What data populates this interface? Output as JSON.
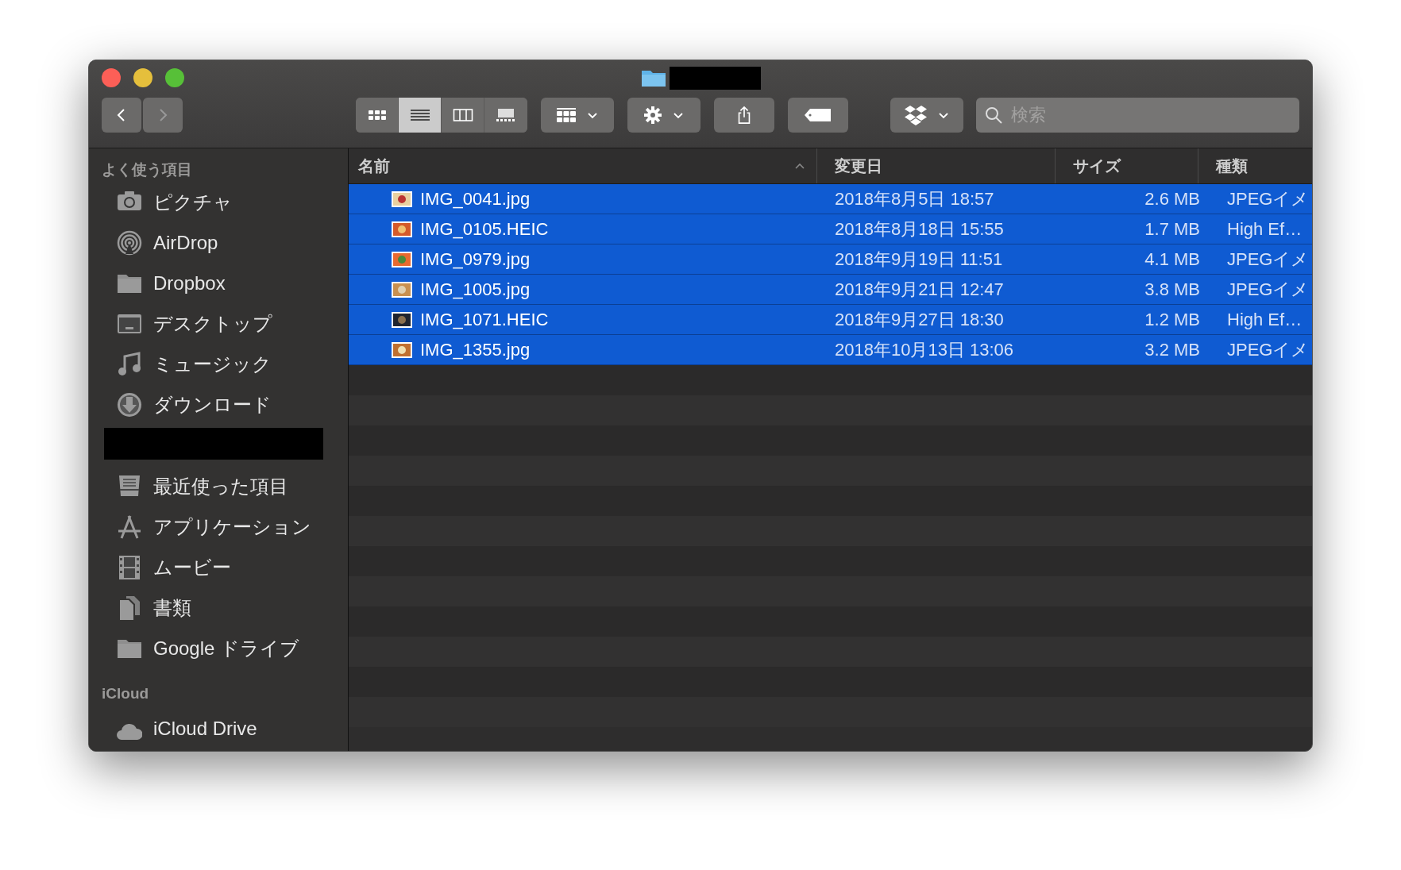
{
  "toolbar": {
    "view_modes": [
      {
        "kind": "icons",
        "selected": false
      },
      {
        "kind": "list",
        "selected": true
      },
      {
        "kind": "columns",
        "selected": false
      },
      {
        "kind": "gallery",
        "selected": false
      }
    ],
    "search": {
      "placeholder": "検索"
    }
  },
  "sidebar": {
    "sections": [
      {
        "heading": "よく使う項目",
        "items": [
          {
            "label": "ピクチャ",
            "kind": "camera"
          },
          {
            "label": "AirDrop",
            "kind": "airdrop"
          },
          {
            "label": "Dropbox",
            "kind": "folder"
          },
          {
            "label": "デスクトップ",
            "kind": "desktop"
          },
          {
            "label": "ミュージック",
            "kind": "music"
          },
          {
            "label": "ダウンロード",
            "kind": "download"
          },
          {
            "kind": "redacted"
          },
          {
            "label": "最近使った項目",
            "kind": "recents"
          },
          {
            "label": "アプリケーション",
            "kind": "apps"
          },
          {
            "label": "ムービー",
            "kind": "movies"
          },
          {
            "label": "書類",
            "kind": "documents"
          },
          {
            "label": "Google ドライブ",
            "kind": "folder"
          }
        ]
      },
      {
        "heading": "iCloud",
        "items": [
          {
            "label": "iCloud Drive",
            "kind": "cloud"
          }
        ]
      }
    ]
  },
  "table": {
    "columns": [
      {
        "label": "名前",
        "sorted": true
      },
      {
        "label": "変更日",
        "sorted": false
      },
      {
        "label": "サイズ",
        "sorted": false
      },
      {
        "label": "種類",
        "sorted": false
      }
    ],
    "rows": [
      {
        "name": "IMG_0041.jpg",
        "date": "2018年8月5日 18:57",
        "size": "2.6 MB",
        "kind": "JPEGイメ",
        "selected": true
      },
      {
        "name": "IMG_0105.HEIC",
        "date": "2018年8月18日 15:55",
        "size": "1.7 MB",
        "kind": "High Ef…",
        "selected": true
      },
      {
        "name": "IMG_0979.jpg",
        "date": "2018年9月19日 11:51",
        "size": "4.1 MB",
        "kind": "JPEGイメ",
        "selected": true
      },
      {
        "name": "IMG_1005.jpg",
        "date": "2018年9月21日 12:47",
        "size": "3.8 MB",
        "kind": "JPEGイメ",
        "selected": true
      },
      {
        "name": "IMG_1071.HEIC",
        "date": "2018年9月27日 18:30",
        "size": "1.2 MB",
        "kind": "High Ef…",
        "selected": true
      },
      {
        "name": "IMG_1355.jpg",
        "date": "2018年10月13日 13:06",
        "size": "3.2 MB",
        "kind": "JPEGイメ",
        "selected": true
      }
    ]
  }
}
